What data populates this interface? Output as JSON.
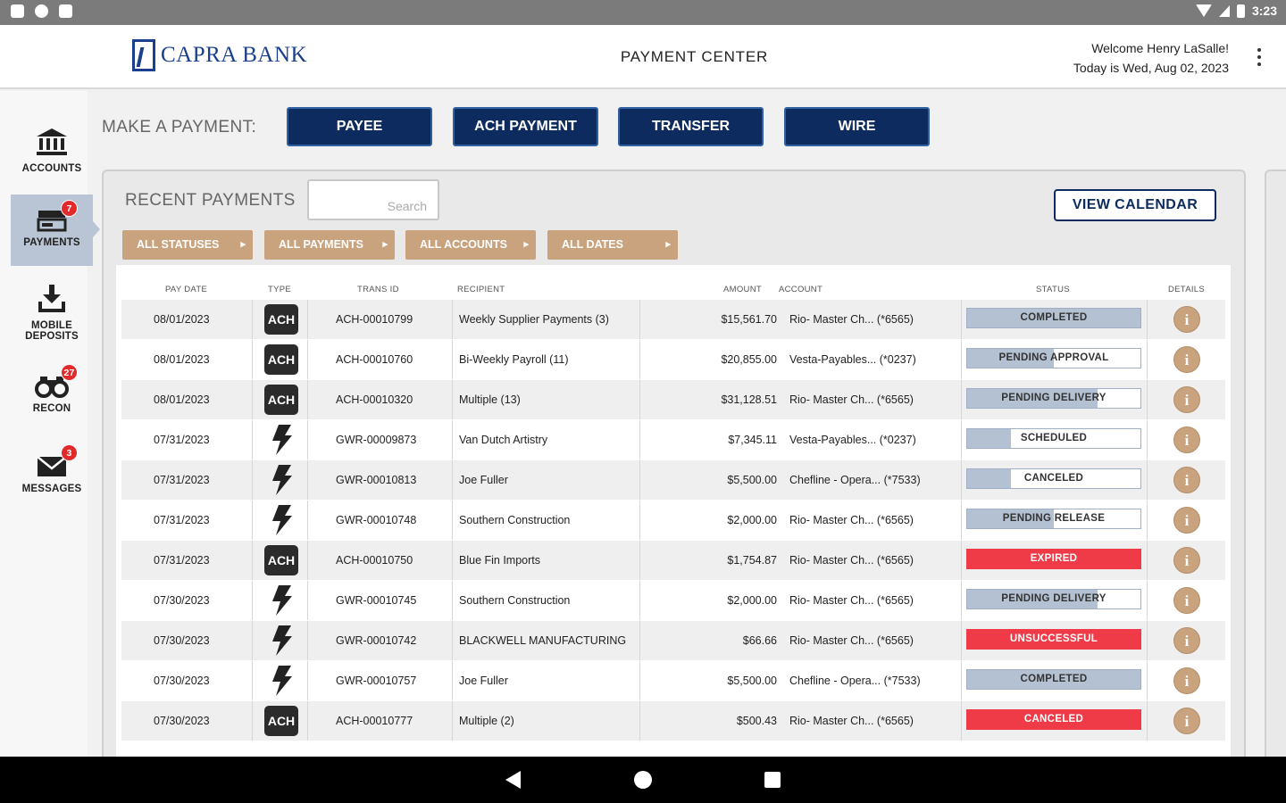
{
  "status_bar": {
    "time": "3:23"
  },
  "header": {
    "brand": "CAPRA BANK",
    "title": "PAYMENT CENTER",
    "welcome": "Welcome Henry LaSalle!",
    "date": "Today is Wed, Aug 02, 2023"
  },
  "sidebar": {
    "items": [
      {
        "label": "ACCOUNTS",
        "icon": "bank-icon"
      },
      {
        "label": "PAYMENTS",
        "icon": "payments-icon",
        "badge": "7",
        "active": true
      },
      {
        "label_line1": "MOBILE",
        "label_line2": "DEPOSITS",
        "icon": "mobile-deposit-icon"
      },
      {
        "label": "RECON",
        "icon": "binoculars-icon",
        "badge": "27"
      },
      {
        "label": "MESSAGES",
        "icon": "envelope-icon",
        "badge": "3"
      }
    ]
  },
  "make_payment": {
    "label": "MAKE A PAYMENT:",
    "buttons": [
      "PAYEE",
      "ACH PAYMENT",
      "TRANSFER",
      "WIRE"
    ]
  },
  "recent": {
    "label": "RECENT PAYMENTS",
    "search_placeholder": "Search",
    "calendar_button": "VIEW CALENDAR",
    "filters": [
      "ALL STATUSES",
      "ALL PAYMENTS",
      "ALL ACCOUNTS",
      "ALL DATES"
    ]
  },
  "table": {
    "columns": [
      "PAY DATE",
      "TYPE",
      "TRANS ID",
      "RECIPIENT",
      "AMOUNT",
      "ACCOUNT",
      "STATUS",
      "DETAILS"
    ],
    "rows": [
      {
        "date": "08/01/2023",
        "type": "ACH",
        "trans_id": "ACH-00010799",
        "recipient": "Weekly Supplier Payments (3)",
        "amount": "$15,561.70",
        "account": "Rio- Master Ch...  (*6565)",
        "status": "COMPLETED",
        "progress": 1.0,
        "tone": "gray"
      },
      {
        "date": "08/01/2023",
        "type": "ACH",
        "trans_id": "ACH-00010760",
        "recipient": "Bi-Weekly Payroll (11)",
        "amount": "$20,855.00",
        "account": "Vesta-Payables...  (*0237)",
        "status": "PENDING APPROVAL",
        "progress": 0.5,
        "tone": "gray"
      },
      {
        "date": "08/01/2023",
        "type": "ACH",
        "trans_id": "ACH-00010320",
        "recipient": "Multiple (13)",
        "amount": "$31,128.51",
        "account": "Rio- Master Ch...  (*6565)",
        "status": "PENDING DELIVERY",
        "progress": 0.75,
        "tone": "gray"
      },
      {
        "date": "07/31/2023",
        "type": "WIRE",
        "trans_id": "GWR-00009873",
        "recipient": "Van Dutch Artistry",
        "amount": "$7,345.11",
        "account": "Vesta-Payables...  (*0237)",
        "status": "SCHEDULED",
        "progress": 0.25,
        "tone": "gray"
      },
      {
        "date": "07/31/2023",
        "type": "WIRE",
        "trans_id": "GWR-00010813",
        "recipient": "Joe Fuller",
        "amount": "$5,500.00",
        "account": "Chefline - Opera...  (*7533)",
        "status": "CANCELED",
        "progress": 0.25,
        "tone": "gray"
      },
      {
        "date": "07/31/2023",
        "type": "WIRE",
        "trans_id": "GWR-00010748",
        "recipient": "Southern Construction",
        "amount": "$2,000.00",
        "account": "Rio- Master Ch...  (*6565)",
        "status": "PENDING RELEASE",
        "progress": 0.5,
        "tone": "gray"
      },
      {
        "date": "07/31/2023",
        "type": "ACH",
        "trans_id": "ACH-00010750",
        "recipient": "Blue Fin Imports",
        "amount": "$1,754.87",
        "account": "Rio- Master Ch...  (*6565)",
        "status": "EXPIRED",
        "progress": 1.0,
        "tone": "red"
      },
      {
        "date": "07/30/2023",
        "type": "WIRE",
        "trans_id": "GWR-00010745",
        "recipient": "Southern Construction",
        "amount": "$2,000.00",
        "account": "Rio- Master Ch...  (*6565)",
        "status": "PENDING DELIVERY",
        "progress": 0.75,
        "tone": "gray"
      },
      {
        "date": "07/30/2023",
        "type": "WIRE",
        "trans_id": "GWR-00010742",
        "recipient": "BLACKWELL MANUFACTURING",
        "amount": "$66.66",
        "account": "Rio- Master Ch...  (*6565)",
        "status": "UNSUCCESSFUL",
        "progress": 1.0,
        "tone": "red"
      },
      {
        "date": "07/30/2023",
        "type": "WIRE",
        "trans_id": "GWR-00010757",
        "recipient": "Joe Fuller",
        "amount": "$5,500.00",
        "account": "Chefline - Opera...  (*7533)",
        "status": "COMPLETED",
        "progress": 1.0,
        "tone": "gray"
      },
      {
        "date": "07/30/2023",
        "type": "ACH",
        "trans_id": "ACH-00010777",
        "recipient": "Multiple (2)",
        "amount": "$500.43",
        "account": "Rio- Master Ch...  (*6565)",
        "status": "CANCELED",
        "progress": 1.0,
        "tone": "red"
      }
    ]
  },
  "colors": {
    "navy": "#0d2b5e",
    "tan": "#c9a37e",
    "status_gray": "#b3c1d2",
    "status_red": "#ef3b48",
    "badge_red": "#e32a2a"
  }
}
